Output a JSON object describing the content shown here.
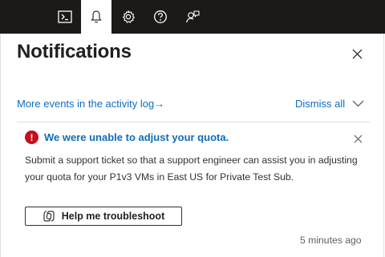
{
  "topbar": {
    "icons": [
      "cloud-shell-icon",
      "bell-icon",
      "gear-icon",
      "help-icon",
      "feedback-icon"
    ],
    "active": "bell-icon"
  },
  "panel": {
    "title": "Notifications",
    "activity_link": "More events in the activity log",
    "activity_arrow": "→",
    "dismiss_label": "Dismiss all"
  },
  "notification": {
    "status": "error",
    "status_color": "#c50f1f",
    "title": "We were unable to adjust your quota.",
    "body": "Submit a support ticket so that a support engineer can assist you in adjusting your quota for your P1v3 VMs in East US for Private Test Sub.",
    "action_label": "Help me troubleshoot",
    "timestamp": "5 minutes ago"
  },
  "colors": {
    "accent": "#0f6cbd",
    "topbar": "#1b1a19"
  }
}
